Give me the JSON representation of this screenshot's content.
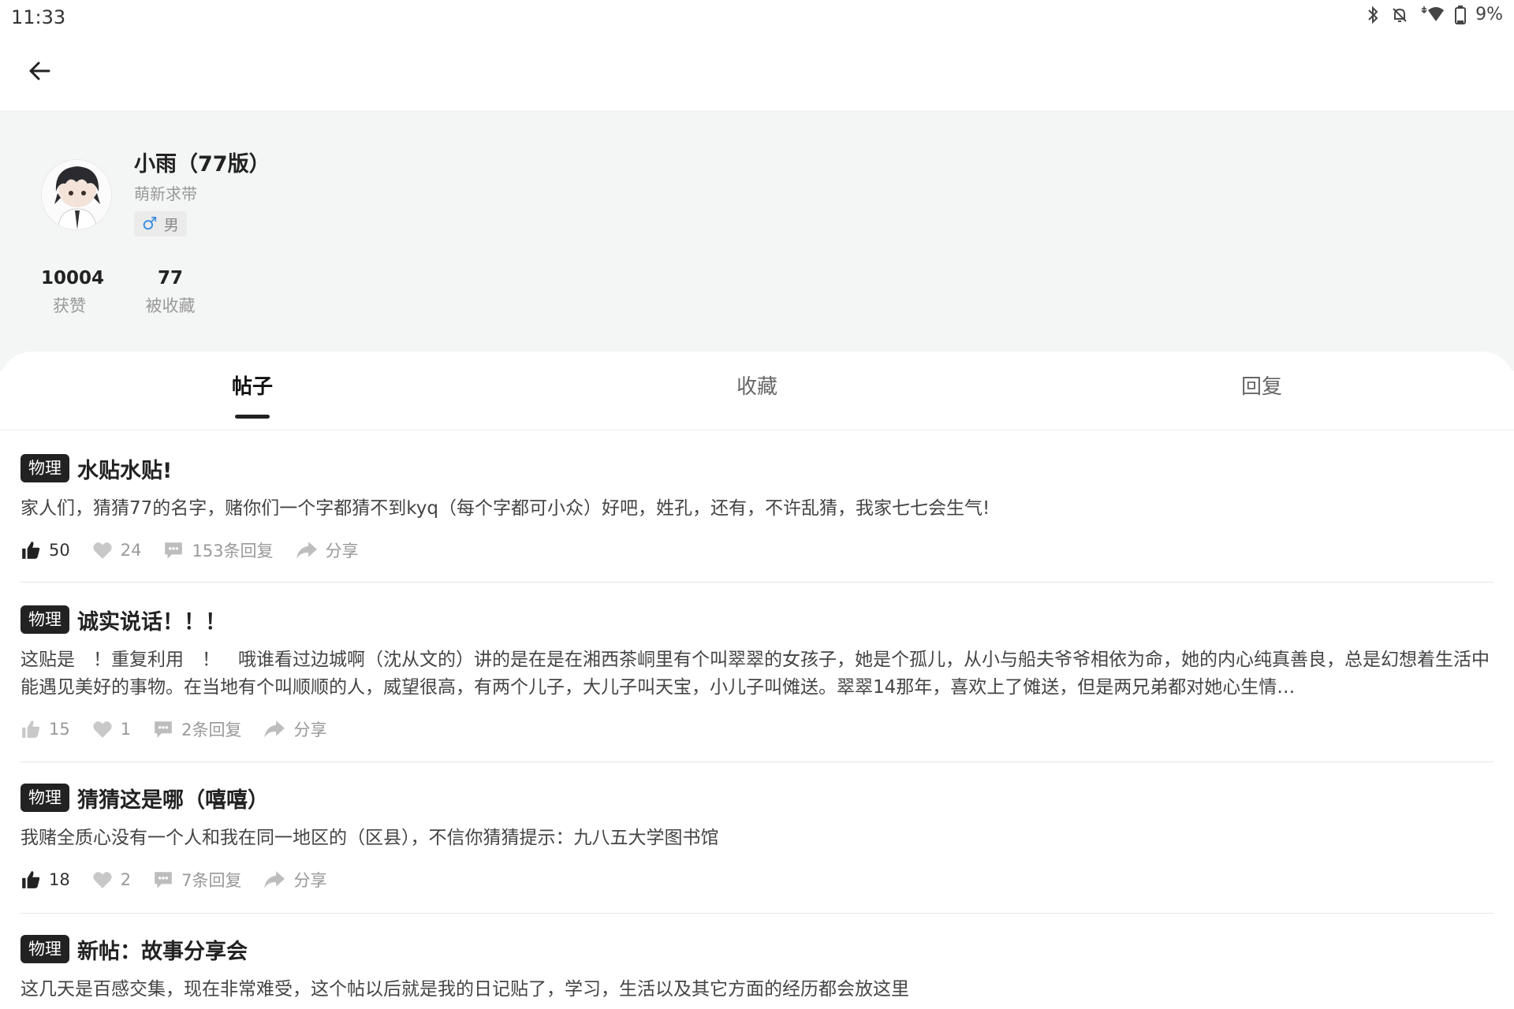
{
  "status_bar": {
    "time": "11:33",
    "battery": "9%"
  },
  "profile": {
    "name": "小雨（77版）",
    "title": "萌新求带",
    "gender_symbol": "♂",
    "gender": "男",
    "stats": [
      {
        "value": "10004",
        "label": "获赞"
      },
      {
        "value": "77",
        "label": "被收藏"
      }
    ]
  },
  "tabs": [
    {
      "label": "帖子",
      "active": true
    },
    {
      "label": "收藏",
      "active": false
    },
    {
      "label": "回复",
      "active": false
    }
  ],
  "posts": [
    {
      "tag": "物理",
      "title": "水贴水贴!",
      "body": "家人们，猜猜77的名字，赌你们一个字都猜不到kyq（每个字都可小众）好吧，姓孔，还有，不许乱猜，我家七七会生气!",
      "likes": "50",
      "liked": true,
      "hearts": "24",
      "replies": "153条回复",
      "share": "分享"
    },
    {
      "tag": "物理",
      "title": "诚实说话！！！",
      "body": "这贴是　！重复利用　！　哦谁看过边城啊（沈从文的）讲的是在是在湘西茶峒里有个叫翠翠的女孩子，她是个孤儿，从小与船夫爷爷相依为命，她的内心纯真善良，总是幻想着生活中能遇见美好的事物。在当地有个叫顺顺的人，威望很高，有两个儿子，大儿子叫天宝，小儿子叫傩送。翠翠14那年，喜欢上了傩送，但是两兄弟都对她心生情…",
      "likes": "15",
      "liked": false,
      "hearts": "1",
      "replies": "2条回复",
      "share": "分享"
    },
    {
      "tag": "物理",
      "title": "猜猜这是哪（嘻嘻）",
      "body": "我赌全质心没有一个人和我在同一地区的（区县），不信你猜猜提示：九八五大学图书馆",
      "likes": "18",
      "liked": true,
      "hearts": "2",
      "replies": "7条回复",
      "share": "分享"
    },
    {
      "tag": "物理",
      "title": "新帖：故事分享会",
      "body": "这几天是百感交集，现在非常难受，这个帖以后就是我的日记贴了，学习，生活以及其它方面的经历都会放这里"
    }
  ]
}
